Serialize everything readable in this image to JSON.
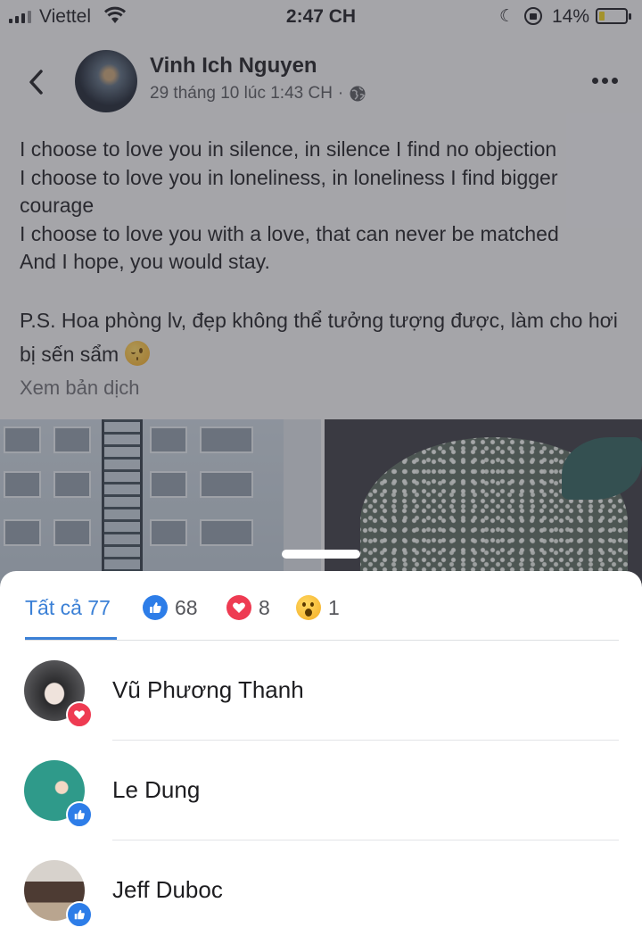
{
  "status_bar": {
    "carrier": "Viettel",
    "time": "2:47 CH",
    "battery_percent": "14%",
    "battery_level": 0.14
  },
  "post": {
    "author": "Vinh Ich Nguyen",
    "timestamp": "29 tháng 10 lúc 1:43 CH",
    "separator": "·",
    "privacy_icon": "globe-icon",
    "text_lines": "I choose to love you in silence, in silence I find no objection\nI choose to love you in loneliness, in loneliness I find bigger courage\nI choose to love you with a love, that can never be matched\nAnd I hope, you would stay.",
    "ps_text": "P.S. Hoa phòng lv, đẹp không thể tưởng tượng được, làm cho hơi bị sến sẩm",
    "ps_emoji": "winking-face-emoji",
    "translate_label": "Xem bản dịch"
  },
  "reactions": {
    "tabs": [
      {
        "label": "Tất cả 77",
        "icon": null
      },
      {
        "label": "68",
        "icon": "like-icon"
      },
      {
        "label": "8",
        "icon": "love-icon"
      },
      {
        "label": "1",
        "icon": "wow-icon"
      }
    ],
    "people": [
      {
        "name": "Vũ Phương Thanh",
        "reaction": "love-icon"
      },
      {
        "name": "Le Dung",
        "reaction": "like-icon"
      },
      {
        "name": "Jeff Duboc",
        "reaction": "like-icon"
      }
    ],
    "colors": {
      "accent": "#3b80d6",
      "like": "#2d7de8",
      "love": "#ee3b52"
    }
  }
}
